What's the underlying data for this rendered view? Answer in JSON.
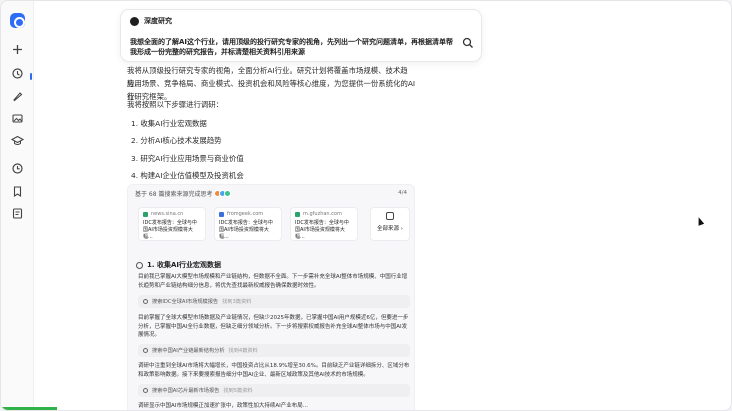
{
  "sidebar": {
    "items": [
      {
        "name": "new-chat-icon",
        "glyph": "+"
      },
      {
        "name": "history-icon",
        "glyph": ""
      },
      {
        "name": "brush-icon",
        "glyph": ""
      },
      {
        "name": "image-icon",
        "glyph": ""
      },
      {
        "name": "graduation-icon",
        "glyph": ""
      },
      {
        "name": "clock-icon",
        "glyph": ""
      },
      {
        "name": "bookmark-icon",
        "glyph": ""
      },
      {
        "name": "notes-icon",
        "glyph": ""
      }
    ]
  },
  "query_card": {
    "title": "深度研究",
    "query": "我想全面的了解AI这个行业，请用顶级的投行研究专家的视角，先列出一个研究问题清单，再根据清单帮我形成一份完整的研究报告，并标清楚相关资料引用来源"
  },
  "intro": {
    "line1": "我将从顶级投行研究专家的视角，全面分析AI行业。研究计划将覆盖市场规模、技术趋势、",
    "line2": "应用场景、竞争格局、商业模式、投资机会和风险等核心维度，为您提供一份系统化的AI行",
    "line3": "业研究框架。",
    "plan_label": "我将按照以下步骤进行调研："
  },
  "steps": [
    "1. 收集AI行业宏观数据",
    "2. 分析AI核心技术发展趋势",
    "3. 研究AI行业应用场景与商业价值",
    "4. 构建AI企业估值模型及投资机会"
  ],
  "sources": {
    "header": "基于 68 篇搜索来源完成思考",
    "page": "4/4",
    "avatar_colors": [
      "#f08a3c",
      "#4aa3f0",
      "#3cc38a"
    ],
    "refs": [
      {
        "site": "news.sina.cn",
        "title": "IDC发布报告：全球与中国AI市场投资规模将大幅..."
      },
      {
        "site": "fromgeek.com",
        "title": "IDC发布报告：全球与中国AI市场投资规模将大幅..."
      },
      {
        "site": "m.gfuzhan.com",
        "title": "IDC发布报告：全球与中国AI市场投资规模将大幅..."
      }
    ],
    "all_label": "全部来源 ›"
  },
  "section": {
    "title": "1. 收集AI行业宏观数据",
    "p1": "目前我已掌握AI大模型市场规模和产业链结构，但数据不全面。下一步需补充全球AI整体市场规模、中国行业增长趋势和产业链结构细分信息，将优先查找最新权威报告确保数据时效性。",
    "s1": "搜索IDC全球AI市场规模报告",
    "s1_count": "找到3篇资料",
    "p2": "目前掌握了全球大模型市场数据及产业链情况，但缺少2025年数据，已掌握中国AI用户规模近6亿，但要进一步分析，已掌握中国AI全行业数据，但缺乏细分领域分析。下一步将搜索权威报告补充全球AI整体市场与中国AI发展情况。",
    "s2": "搜索中国AI产业链最新结构分析",
    "s2_count": "找到4篇资料",
    "p3": "调研中注重到全球AI市场将大幅增长，中国投资占比从18.9%增至30.6%。目前缺乏产业链详细拆分、区域分布和政策影响数据。接下来要搜索报告细分中国AI企业、最新区域政策及其他AI技术的市场规模。",
    "s3": "搜索中国AI芯片最新市场报告",
    "s3_count": "找到5篇资料",
    "p4": "调研显示中国AI市场规模正加速扩张中，政策性加大持续AI产业布局..."
  }
}
